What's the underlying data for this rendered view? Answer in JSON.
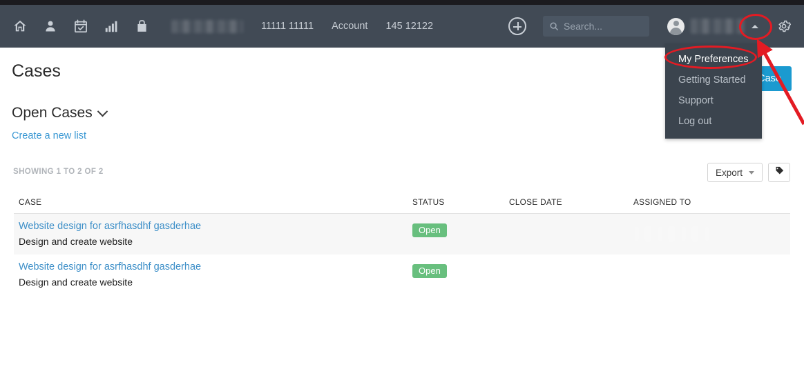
{
  "navbar": {
    "icons": [
      {
        "name": "home-icon",
        "label": "Home"
      },
      {
        "name": "contacts-icon",
        "label": "Contacts"
      },
      {
        "name": "calendar-check-icon",
        "label": "Calendar"
      },
      {
        "name": "bar-chart-icon",
        "label": "Reports"
      },
      {
        "name": "briefcase-icon",
        "label": "Cases"
      }
    ],
    "blurred_item_label": "",
    "links": [
      "11111 11111",
      "Account",
      "145 12122"
    ],
    "add_button": "add-icon",
    "search": {
      "placeholder": "Search...",
      "value": "",
      "icon": "search-icon"
    },
    "user": {
      "avatar": "avatar-icon",
      "name_redacted": "",
      "caret": "caret-up-icon"
    },
    "settings_icon": "gear-icon"
  },
  "user_menu": {
    "items": [
      {
        "label": "My Preferences",
        "highlighted": true
      },
      {
        "label": "Getting Started",
        "highlighted": false
      },
      {
        "label": "Support",
        "highlighted": false
      },
      {
        "label": "Log out",
        "highlighted": false
      }
    ]
  },
  "page": {
    "title": "Cases",
    "new_case_button": "New Case",
    "list_name": "Open Cases",
    "create_list_link": "Create a new list",
    "showing_text": "SHOWING 1 TO 2 OF 2"
  },
  "toolbar": {
    "export_label": "Export",
    "tag_icon": "tag-icon"
  },
  "table": {
    "columns": [
      "CASE",
      "STATUS",
      "CLOSE DATE",
      "ASSIGNED TO"
    ],
    "rows": [
      {
        "case": "Website design for asrfhasdhf gasderhae",
        "subtitle": "Design and create website",
        "status": "Open",
        "close_date": "",
        "assigned_to": ""
      },
      {
        "case": "Website design for asrfhasdhf gasderhae",
        "subtitle": "Design and create website",
        "status": "Open",
        "close_date": "",
        "assigned_to": ""
      }
    ]
  },
  "annotations": {
    "circle_caret": "red-ellipse-highlight-user-caret",
    "circle_preferences": "red-ellipse-highlight-my-preferences",
    "arrow": "red-arrow-pointing-to-my-preferences",
    "color": "#e31b23"
  },
  "colors": {
    "navbar_bg": "#414a55",
    "menu_bg": "#3b444e",
    "accent_blue": "#1b9ad0",
    "link_blue": "#3d8fc8",
    "status_green": "#68bf7e",
    "annotation_red": "#e31b23"
  }
}
